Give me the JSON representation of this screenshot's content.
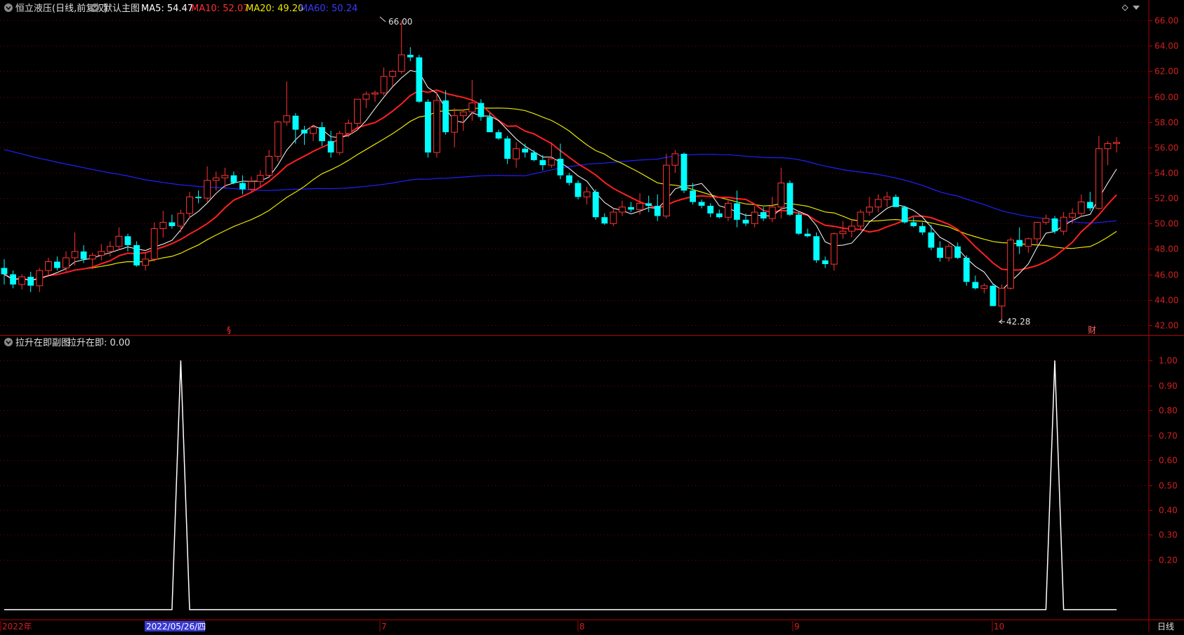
{
  "main_header": {
    "stock": "恒立液压(日线,前复权)",
    "chart_name": "默认主图",
    "ma5": "MA5: 54.47",
    "ma10": "MA10: 52.07",
    "ma20": "MA20: 49.20",
    "ma60": "MA60: 50.24"
  },
  "sub_header": {
    "chart_name": "拉升在即副图",
    "value": "拉升在即: 0.00"
  },
  "markers": {
    "high_label": "66.00",
    "low_label": "42.28",
    "s_marker": "§",
    "cai_marker": "财"
  },
  "x_axis": {
    "year": "2022年",
    "selected_date": "2022/05/26/四",
    "months": [
      "7",
      "8",
      "9",
      "10"
    ],
    "period_button": "日线"
  },
  "colors": {
    "up": "#ff3232",
    "down": "#00ffff",
    "ma5": "#ffffff",
    "ma10": "#ff2020",
    "ma20": "#e8e800",
    "ma60": "#2020ff",
    "axis": "#b00000",
    "grid": "#7a0000"
  },
  "chart_data": [
    {
      "type": "candlestick",
      "y_ticks": [
        "42.00",
        "44.00",
        "46.00",
        "48.00",
        "50.00",
        "52.00",
        "54.00",
        "56.00",
        "58.00",
        "60.00",
        "62.00",
        "64.00",
        "66.00"
      ],
      "ylim": [
        41.6,
        66.4
      ],
      "ohlc": [
        [
          46.5,
          47.2,
          45.2,
          46.0
        ],
        [
          46.0,
          46.3,
          44.9,
          45.2
        ],
        [
          45.2,
          46.0,
          44.8,
          45.8
        ],
        [
          45.8,
          46.2,
          44.6,
          45.1
        ],
        [
          45.1,
          46.5,
          44.6,
          46.3
        ],
        [
          46.3,
          47.3,
          45.9,
          47.0
        ],
        [
          47.0,
          47.4,
          46.3,
          46.5
        ],
        [
          46.5,
          47.8,
          46.2,
          47.3
        ],
        [
          47.3,
          49.3,
          46.7,
          47.8
        ],
        [
          47.8,
          48.3,
          46.9,
          47.2
        ],
        [
          47.2,
          47.7,
          46.4,
          47.5
        ],
        [
          47.5,
          48.4,
          47.1,
          47.8
        ],
        [
          47.8,
          48.6,
          47.4,
          48.2
        ],
        [
          48.2,
          49.7,
          47.9,
          49.0
        ],
        [
          49.0,
          49.2,
          47.8,
          48.3
        ],
        [
          48.3,
          48.6,
          46.6,
          46.7
        ],
        [
          46.7,
          47.7,
          46.3,
          47.2
        ],
        [
          47.2,
          50.1,
          47.0,
          49.6
        ],
        [
          49.6,
          51.0,
          48.9,
          50.1
        ],
        [
          50.1,
          50.7,
          49.6,
          49.8
        ],
        [
          49.8,
          51.1,
          49.3,
          50.8
        ],
        [
          50.8,
          52.5,
          50.4,
          52.1
        ],
        [
          52.1,
          52.6,
          51.6,
          52.0
        ],
        [
          52.0,
          54.5,
          51.7,
          53.4
        ],
        [
          53.4,
          54.1,
          52.6,
          53.6
        ],
        [
          53.6,
          54.4,
          52.8,
          53.8
        ],
        [
          53.8,
          54.1,
          53.1,
          53.2
        ],
        [
          53.2,
          53.8,
          52.3,
          52.7
        ],
        [
          52.7,
          53.7,
          52.5,
          53.3
        ],
        [
          53.3,
          54.2,
          52.9,
          53.8
        ],
        [
          53.8,
          55.8,
          53.6,
          55.3
        ],
        [
          55.3,
          58.1,
          54.9,
          58.0
        ],
        [
          58.0,
          61.2,
          57.7,
          58.5
        ],
        [
          58.5,
          58.7,
          56.3,
          57.4
        ],
        [
          57.4,
          57.7,
          56.2,
          57.1
        ],
        [
          57.1,
          57.8,
          56.5,
          57.6
        ],
        [
          57.6,
          58.0,
          56.1,
          56.5
        ],
        [
          56.5,
          57.3,
          55.2,
          55.6
        ],
        [
          55.6,
          57.3,
          55.4,
          57.1
        ],
        [
          57.1,
          58.2,
          56.8,
          57.9
        ],
        [
          57.9,
          59.8,
          57.3,
          59.8
        ],
        [
          59.8,
          60.4,
          59.1,
          60.2
        ],
        [
          60.2,
          60.5,
          59.6,
          60.3
        ],
        [
          60.3,
          62.3,
          60.1,
          61.6
        ],
        [
          61.6,
          62.1,
          60.8,
          62.0
        ],
        [
          62.0,
          66.0,
          61.8,
          63.3
        ],
        [
          63.3,
          63.9,
          62.8,
          63.1
        ],
        [
          63.1,
          63.3,
          59.5,
          59.6
        ],
        [
          59.6,
          59.8,
          55.2,
          55.6
        ],
        [
          55.6,
          60.4,
          55.2,
          59.7
        ],
        [
          59.7,
          60.5,
          57.0,
          57.2
        ],
        [
          57.2,
          59.1,
          56.0,
          58.5
        ],
        [
          58.5,
          59.0,
          57.3,
          58.8
        ],
        [
          58.8,
          61.3,
          58.1,
          59.5
        ],
        [
          59.5,
          59.8,
          58.1,
          58.4
        ],
        [
          58.4,
          58.7,
          57.2,
          57.2
        ],
        [
          57.2,
          57.4,
          56.6,
          56.7
        ],
        [
          56.7,
          56.9,
          54.7,
          55.1
        ],
        [
          55.1,
          56.4,
          54.4,
          55.9
        ],
        [
          55.9,
          56.3,
          55.2,
          55.6
        ],
        [
          55.6,
          55.8,
          54.9,
          55.0
        ],
        [
          55.0,
          55.4,
          54.2,
          54.6
        ],
        [
          54.6,
          56.4,
          54.4,
          55.1
        ],
        [
          55.1,
          56.3,
          53.5,
          53.8
        ],
        [
          53.8,
          54.0,
          53.0,
          53.2
        ],
        [
          53.2,
          53.4,
          51.9,
          52.1
        ],
        [
          52.1,
          52.9,
          51.5,
          52.5
        ],
        [
          52.5,
          52.7,
          50.3,
          50.5
        ],
        [
          50.5,
          50.8,
          49.9,
          50.0
        ],
        [
          50.0,
          51.2,
          49.8,
          50.9
        ],
        [
          50.9,
          51.8,
          50.6,
          51.3
        ],
        [
          51.3,
          51.7,
          50.9,
          51.1
        ],
        [
          51.1,
          52.4,
          50.7,
          51.6
        ],
        [
          51.6,
          52.2,
          50.9,
          51.4
        ],
        [
          51.4,
          52.3,
          50.2,
          50.6
        ],
        [
          50.6,
          55.5,
          50.4,
          54.6
        ],
        [
          54.6,
          55.8,
          54.0,
          55.5
        ],
        [
          55.5,
          55.6,
          52.4,
          52.6
        ],
        [
          52.6,
          53.2,
          51.5,
          51.7
        ],
        [
          51.7,
          51.9,
          51.2,
          51.4
        ],
        [
          51.4,
          51.6,
          50.5,
          50.8
        ],
        [
          50.8,
          51.1,
          50.4,
          50.5
        ],
        [
          50.5,
          51.9,
          50.2,
          51.6
        ],
        [
          51.6,
          52.6,
          49.7,
          50.3
        ],
        [
          50.3,
          50.8,
          49.8,
          50.0
        ],
        [
          50.0,
          51.4,
          49.7,
          50.9
        ],
        [
          50.9,
          51.3,
          50.2,
          50.4
        ],
        [
          50.4,
          52.1,
          50.1,
          51.3
        ],
        [
          51.3,
          54.4,
          50.4,
          53.2
        ],
        [
          53.2,
          53.4,
          50.6,
          50.7
        ],
        [
          50.7,
          50.9,
          49.1,
          49.2
        ],
        [
          49.2,
          49.6,
          48.9,
          49.0
        ],
        [
          49.0,
          49.3,
          46.9,
          47.1
        ],
        [
          47.1,
          47.4,
          46.5,
          46.8
        ],
        [
          46.8,
          49.3,
          46.3,
          49.2
        ],
        [
          49.2,
          50.2,
          48.8,
          49.4
        ],
        [
          49.4,
          50.3,
          48.9,
          49.8
        ],
        [
          49.8,
          51.1,
          49.5,
          50.9
        ],
        [
          50.9,
          52.1,
          50.6,
          51.3
        ],
        [
          51.3,
          52.3,
          50.9,
          51.9
        ],
        [
          51.9,
          52.5,
          51.3,
          52.1
        ],
        [
          52.1,
          52.3,
          51.3,
          51.3
        ],
        [
          51.3,
          51.4,
          50.0,
          50.1
        ],
        [
          50.1,
          50.5,
          49.7,
          49.8
        ],
        [
          49.8,
          50.1,
          49.1,
          49.3
        ],
        [
          49.3,
          49.9,
          47.9,
          48.1
        ],
        [
          48.1,
          48.6,
          47.0,
          47.3
        ],
        [
          47.3,
          48.4,
          47.0,
          48.2
        ],
        [
          48.2,
          48.5,
          47.2,
          47.3
        ],
        [
          47.3,
          47.5,
          45.1,
          45.4
        ],
        [
          45.4,
          45.9,
          44.8,
          44.9
        ],
        [
          44.9,
          45.3,
          44.5,
          45.1
        ],
        [
          45.1,
          45.3,
          43.6,
          43.5
        ],
        [
          43.5,
          45.2,
          42.3,
          44.9
        ],
        [
          44.9,
          48.9,
          44.8,
          48.7
        ],
        [
          48.7,
          49.7,
          47.6,
          48.2
        ],
        [
          48.2,
          48.9,
          47.7,
          48.8
        ],
        [
          48.8,
          49.8,
          48.3,
          50.1
        ],
        [
          50.1,
          50.7,
          49.9,
          50.4
        ],
        [
          50.4,
          50.6,
          49.2,
          49.4
        ],
        [
          49.4,
          50.9,
          49.1,
          50.5
        ],
        [
          50.5,
          51.2,
          50.0,
          50.8
        ],
        [
          50.8,
          52.3,
          50.5,
          51.7
        ],
        [
          51.7,
          52.5,
          51.0,
          51.2
        ],
        [
          51.2,
          56.9,
          51.1,
          55.9
        ],
        [
          55.9,
          56.5,
          54.6,
          56.3
        ],
        [
          56.3,
          56.8,
          55.6,
          56.4
        ]
      ]
    },
    {
      "type": "line",
      "title": "拉升在即",
      "y_ticks": [
        "0.20",
        "0.30",
        "0.40",
        "0.50",
        "0.60",
        "0.70",
        "0.80",
        "0.90",
        "1.00"
      ],
      "ylim": [
        -0.02,
        1.04
      ],
      "signal_bar_index": [
        20,
        119
      ]
    }
  ]
}
